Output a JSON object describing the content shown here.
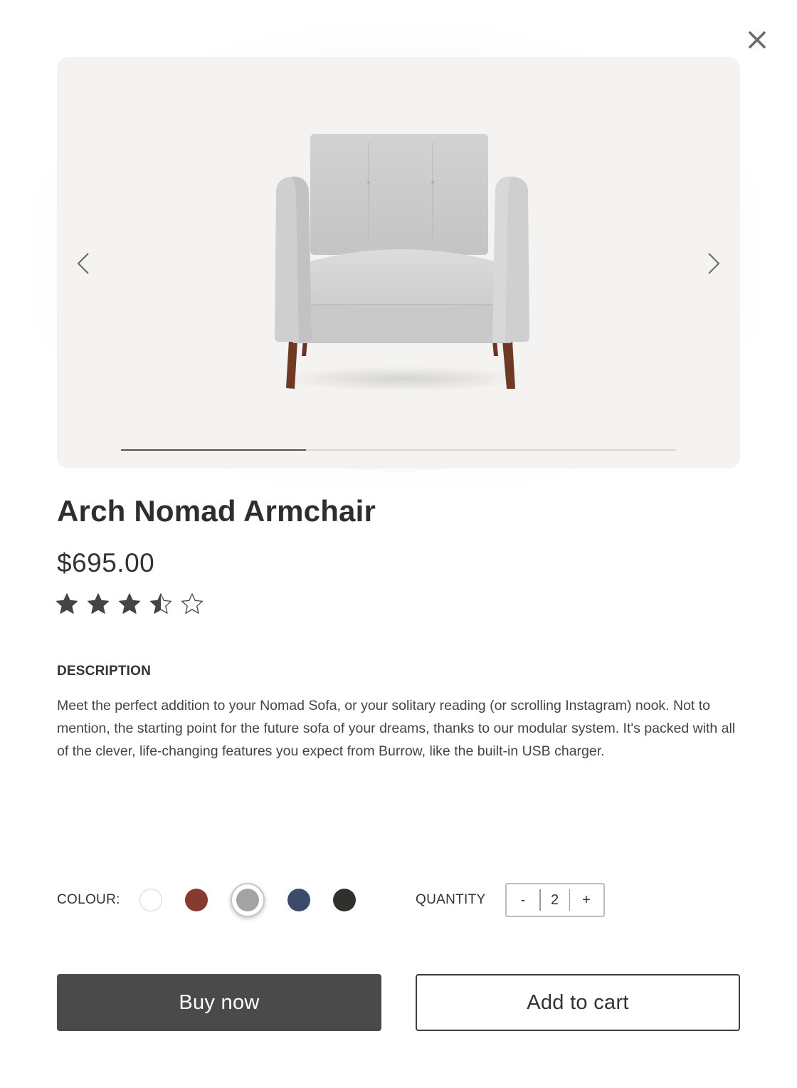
{
  "product": {
    "title": "Arch Nomad Armchair",
    "price": "$695.00",
    "rating": 3.5,
    "rating_max": 5
  },
  "gallery": {
    "image": "armchair-front-view",
    "current_slide": 1,
    "total_slides": 3,
    "progress_fraction": 0.333
  },
  "description": {
    "heading": "DESCRIPTION",
    "text": "Meet the perfect addition to your Nomad Sofa, or your solitary reading (or scrolling Instagram) nook. Not to mention, the starting point for the future sofa of your dreams, thanks to our modular system. It's packed with all of the clever, life-changing features you expect from Burrow, like the built-in USB charger."
  },
  "options": {
    "colour_label": "COLOUR:",
    "colours": [
      {
        "name": "white",
        "hex": "#ffffff",
        "selected": false
      },
      {
        "name": "red",
        "hex": "#873a30",
        "selected": false
      },
      {
        "name": "grey",
        "hex": "#a3a3a3",
        "selected": true
      },
      {
        "name": "blue",
        "hex": "#3c4b67",
        "selected": false
      },
      {
        "name": "dark",
        "hex": "#31302c",
        "selected": false
      }
    ],
    "quantity_label": "QUANTITY",
    "quantity": "2",
    "decrement": "-",
    "increment": "+"
  },
  "actions": {
    "buy_now": "Buy now",
    "add_to_cart": "Add to cart"
  },
  "icons": {
    "close": "close-icon",
    "prev": "chevron-left-icon",
    "next": "chevron-right-icon",
    "star": "star-icon"
  },
  "colors": {
    "primary_button": "#4a4a4a",
    "gallery_bg": "#f4f3f1"
  }
}
